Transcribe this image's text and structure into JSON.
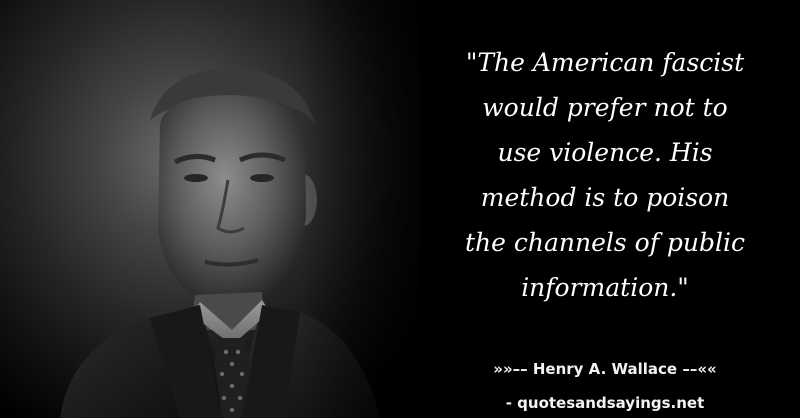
{
  "quote": {
    "lines": [
      "\"The American fascist",
      "would prefer not to",
      "use violence. His",
      "method is to poison",
      "the channels of public",
      "information.\""
    ]
  },
  "author": {
    "line": "»»–– Henry A. Wallace ––««"
  },
  "source": {
    "line": "- quotesandsayings.net"
  },
  "portrait": {
    "subject": "black-and-white portrait photo of a man in suit and tie"
  },
  "colors": {
    "background": "#000000",
    "text": "#ffffff"
  }
}
